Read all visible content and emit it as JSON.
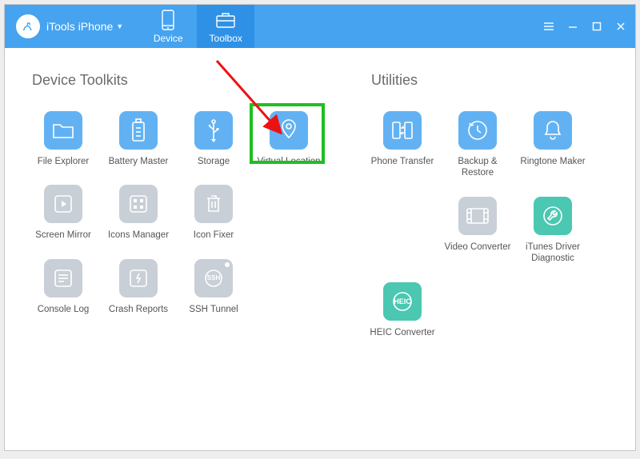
{
  "app": {
    "name": "iTools iPhone"
  },
  "header": {
    "tabs": {
      "device": {
        "label": "Device"
      },
      "toolbox": {
        "label": "Toolbox"
      }
    }
  },
  "sections": {
    "device_toolkits": {
      "title": "Device Toolkits"
    },
    "utilities": {
      "title": "Utilities"
    }
  },
  "toolkits": {
    "file_explorer": {
      "label": "File Explorer"
    },
    "battery_master": {
      "label": "Battery Master"
    },
    "storage": {
      "label": "Storage"
    },
    "virtual_location": {
      "label": "Virtual Location"
    },
    "screen_mirror": {
      "label": "Screen Mirror"
    },
    "icons_manager": {
      "label": "Icons Manager"
    },
    "icon_fixer": {
      "label": "Icon Fixer"
    },
    "console_log": {
      "label": "Console Log"
    },
    "crash_reports": {
      "label": "Crash Reports"
    },
    "ssh_tunnel": {
      "label": "SSH Tunnel"
    }
  },
  "utilities": {
    "phone_transfer": {
      "label": "Phone Transfer"
    },
    "backup_restore": {
      "label": "Backup & Restore"
    },
    "ringtone_maker": {
      "label": "Ringtone Maker"
    },
    "video_converter": {
      "label": "Video Converter"
    },
    "itunes_driver": {
      "label": "iTunes Driver Diagnostic"
    },
    "heic_converter": {
      "label": "HEIC Converter",
      "badge": "HEIC"
    }
  }
}
